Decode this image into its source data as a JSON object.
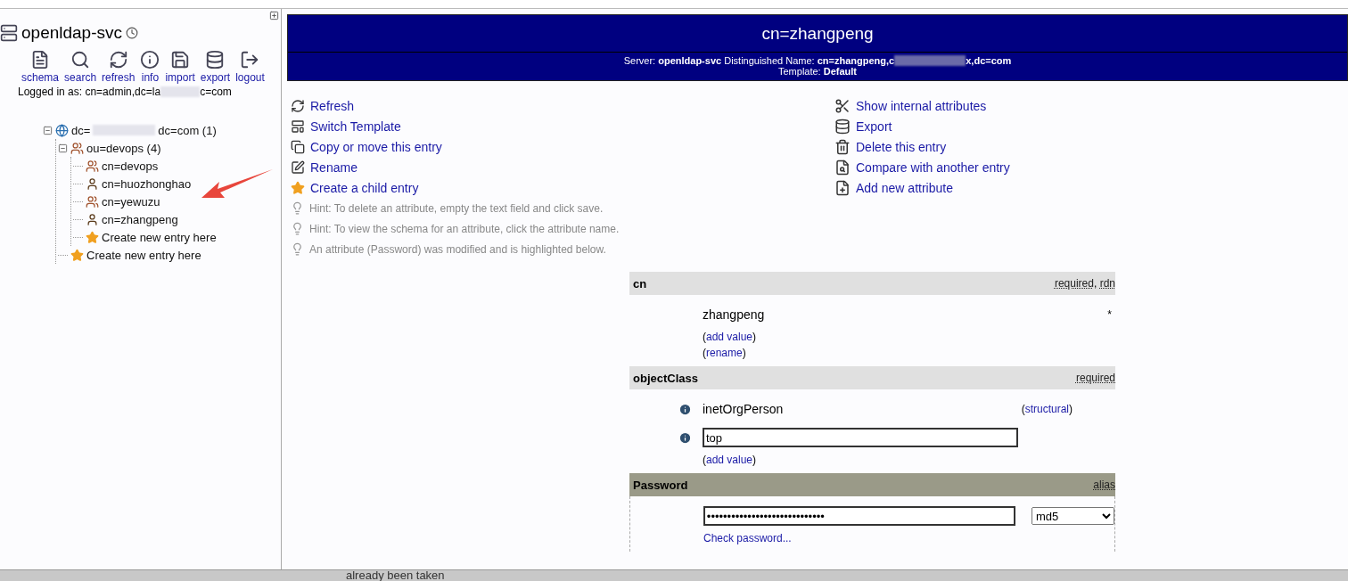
{
  "sidebar": {
    "server": "openldap-svc",
    "toolbar": [
      {
        "kind": "schema",
        "label": "schema"
      },
      {
        "kind": "search",
        "label": "search"
      },
      {
        "kind": "refresh",
        "label": "refresh"
      },
      {
        "kind": "info",
        "label": "info"
      },
      {
        "kind": "import",
        "label": "import"
      },
      {
        "kind": "export",
        "label": "export"
      },
      {
        "kind": "logout",
        "label": "logout"
      }
    ],
    "logged_in": {
      "text": "Logged in as: cn=admin,dc=la",
      "text_after": "c=com"
    },
    "tree": [
      {
        "kind": "globe",
        "label": "dc=",
        "label_after": "dc=com (1)",
        "expanded": true,
        "children": [
          {
            "kind": "group",
            "label": "ou=devops (4)",
            "expanded": true,
            "children": [
              {
                "kind": "group",
                "label": "cn=devops"
              },
              {
                "kind": "person",
                "label": "cn=huozhonghao"
              },
              {
                "kind": "group",
                "label": "cn=yewuzu"
              },
              {
                "kind": "person",
                "label": "cn=zhangpeng"
              },
              {
                "kind": "star",
                "label": "Create new entry here"
              }
            ]
          },
          {
            "kind": "star",
            "label": "Create new entry here"
          }
        ]
      }
    ]
  },
  "header": {
    "title": "cn=zhangpeng",
    "info": "Server: **openldap-svc**   Distinguished Name: **cn=zhangpeng,c**",
    "info_after": "**x,dc=com**",
    "template": "Template: **Default**"
  },
  "actions_left": [
    {
      "kind": "refresh",
      "label": "Refresh"
    },
    {
      "kind": "template",
      "label": "Switch Template"
    },
    {
      "kind": "copy",
      "label": "Copy or move this entry"
    },
    {
      "kind": "rename",
      "label": "Rename"
    },
    {
      "kind": "star",
      "label": "Create a child entry"
    }
  ],
  "actions_right": [
    {
      "kind": "tools",
      "label": "Show internal attributes"
    },
    {
      "kind": "export",
      "label": "Export"
    },
    {
      "kind": "delete",
      "label": "Delete this entry"
    },
    {
      "kind": "compare",
      "label": "Compare with another entry"
    },
    {
      "kind": "add",
      "label": "Add new attribute"
    }
  ],
  "hints": [
    "Hint: To delete an attribute, empty the text field and click save.",
    "Hint: To view the schema for an attribute, click the attribute name.",
    "An attribute (Password) was modified and is highlighted below."
  ],
  "attributes": [
    {
      "name": "cn",
      "flags": [
        "required",
        "rdn"
      ],
      "flag_separator": ",",
      "highlighted": false,
      "values": [
        {
          "kind": "text",
          "value": "zhangpeng",
          "mark": "*"
        }
      ],
      "links": [
        {
          "pre": "(",
          "label": "add value",
          "post": ")"
        },
        {
          "pre": "(",
          "label": "rename",
          "post": ")"
        }
      ]
    },
    {
      "name": "objectClass",
      "flags": [
        "required"
      ],
      "highlighted": false,
      "values": [
        {
          "kind": "static",
          "value": "inetOrgPerson",
          "note": {
            "pre": "(",
            "label": "structural",
            "post": ")"
          }
        },
        {
          "kind": "input",
          "value": "top"
        }
      ],
      "links": [
        {
          "pre": "(",
          "label": "add value",
          "post": ")"
        }
      ]
    },
    {
      "name": "Password",
      "flags": [
        "alias"
      ],
      "highlighted": true,
      "values": [
        {
          "kind": "password",
          "value": "•••••••••••••••••••••••••••••",
          "hash": "md5"
        }
      ],
      "links": [
        {
          "label": "Check password..."
        }
      ]
    }
  ],
  "background_window": {
    "text": "already been taken"
  }
}
